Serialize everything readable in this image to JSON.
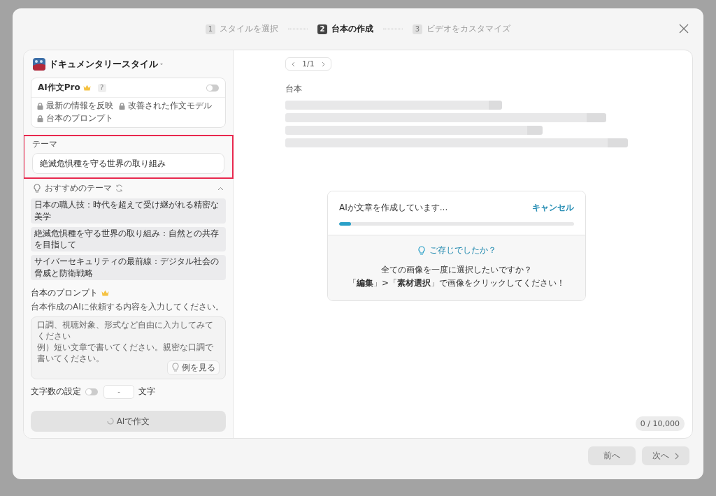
{
  "steps": [
    {
      "number": "1",
      "label": "スタイルを選択",
      "selected": false
    },
    {
      "number": "2",
      "label": "台本の作成",
      "selected": true
    },
    {
      "number": "3",
      "label": "ビデオをカスタマイズ",
      "selected": false
    }
  ],
  "sidebar": {
    "style_title": "ドキュメンタリースタイル",
    "pro_card": {
      "title": "AI作文Pro",
      "help": "?",
      "on": false,
      "features": [
        "最新の情報を反映",
        "改善された作文モデル",
        "台本のプロンプト"
      ]
    },
    "theme": {
      "label": "テーマ",
      "value": "絶滅危惧種を守る世界の取り組み",
      "highlighted": true
    },
    "suggestions": {
      "title": "おすすめのテーマ",
      "expanded": true,
      "items": [
        "日本の職人技：時代を超えて受け継がれる精密な美学",
        "絶滅危惧種を守る世界の取り組み：自然との共存を目指して",
        "サイバーセキュリティの最前線：デジタル社会の脅威と防衛戦略"
      ]
    },
    "prompt": {
      "title": "台本のプロンプト",
      "description": "台本作成のAIに依頼する内容を入力してください。",
      "placeholder": [
        "口調、視聴対象、形式など自由に入力してみてください",
        "例）短い文章で書いてください。親密な口調で書いてください。"
      ],
      "example_button": "例を見る"
    },
    "char_limit": {
      "label": "文字数の設定",
      "on": false,
      "value": "-",
      "unit": "文字"
    },
    "generate_button": {
      "label": "AIで作文",
      "disabled": true
    }
  },
  "main": {
    "pager": "1/1",
    "script_label": "台本",
    "progress": {
      "message": "AIが文章を作成しています...",
      "cancel": "キャンセル",
      "level": 0.05
    },
    "tip": {
      "title": "ご存じでしたか？",
      "lines": [
        "全ての画像を一度に選択したいですか？",
        "「**編集**」>「**素材選択**」で画像をクリックしてください！"
      ]
    },
    "char_count": "0 / 10,000"
  },
  "footer": {
    "buttons": [
      {
        "label": "前へ",
        "disabled": true
      },
      {
        "label": "次へ",
        "disabled": true
      }
    ]
  }
}
